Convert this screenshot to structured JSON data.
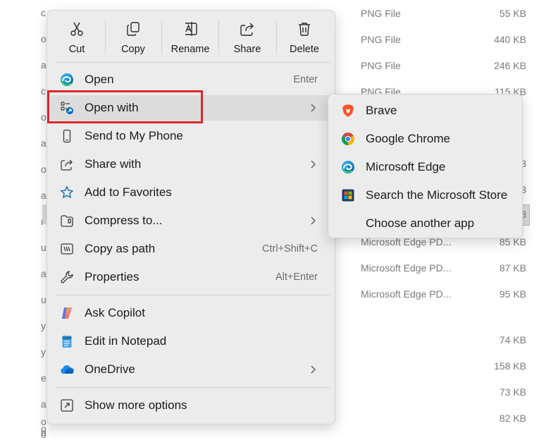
{
  "background": {
    "letters": [
      "c",
      "o",
      "a",
      "c",
      "o",
      "a",
      "o",
      "a",
      "r",
      "u",
      "a",
      "u",
      "y",
      "y",
      "e",
      "a",
      "o",
      "o",
      "o",
      "o"
    ],
    "rows": [
      {
        "type": "PNG File",
        "size": "55 KB"
      },
      {
        "type": "PNG File",
        "size": "440 KB"
      },
      {
        "type": "PNG File",
        "size": "246 KB"
      },
      {
        "type": "PNG File",
        "size": "115 KB"
      },
      {
        "type": "",
        "size": "3"
      },
      {
        "type": "",
        "size": "3"
      },
      {
        "type": "",
        "size": "3"
      },
      {
        "type": "Microsoft Edge PD...",
        "size": "85 KB"
      },
      {
        "type": "Microsoft Edge PD...",
        "size": "87 KB"
      },
      {
        "type": "Microsoft Edge PD...",
        "size": "95 KB"
      },
      {
        "type": "",
        "size": "74 KB"
      },
      {
        "type": "",
        "size": "158 KB"
      },
      {
        "type": "",
        "size": "73 KB"
      },
      {
        "type": "",
        "size": "82 KB"
      }
    ]
  },
  "toolbar": {
    "cut": "Cut",
    "copy": "Copy",
    "rename": "Rename",
    "share": "Share",
    "delete": "Delete"
  },
  "menu": {
    "open": {
      "label": "Open",
      "shortcut": "Enter"
    },
    "open_with": {
      "label": "Open with"
    },
    "send_to_phone": {
      "label": "Send to My Phone"
    },
    "share_with": {
      "label": "Share with"
    },
    "add_favorites": {
      "label": "Add to Favorites"
    },
    "compress": {
      "label": "Compress to..."
    },
    "copy_path": {
      "label": "Copy as path",
      "shortcut": "Ctrl+Shift+C"
    },
    "properties": {
      "label": "Properties",
      "shortcut": "Alt+Enter"
    },
    "ask_copilot": {
      "label": "Ask Copilot"
    },
    "edit_notepad": {
      "label": "Edit in Notepad"
    },
    "onedrive": {
      "label": "OneDrive"
    },
    "show_more": {
      "label": "Show more options"
    }
  },
  "submenu": {
    "brave": "Brave",
    "chrome": "Google Chrome",
    "edge": "Microsoft Edge",
    "store": "Search the Microsoft Store",
    "choose": "Choose another app"
  },
  "colors": {
    "highlight_border": "#e0242b",
    "menu_bg": "#ececec",
    "hover_bg": "#dcdcdc",
    "accent": "#0067c0"
  }
}
